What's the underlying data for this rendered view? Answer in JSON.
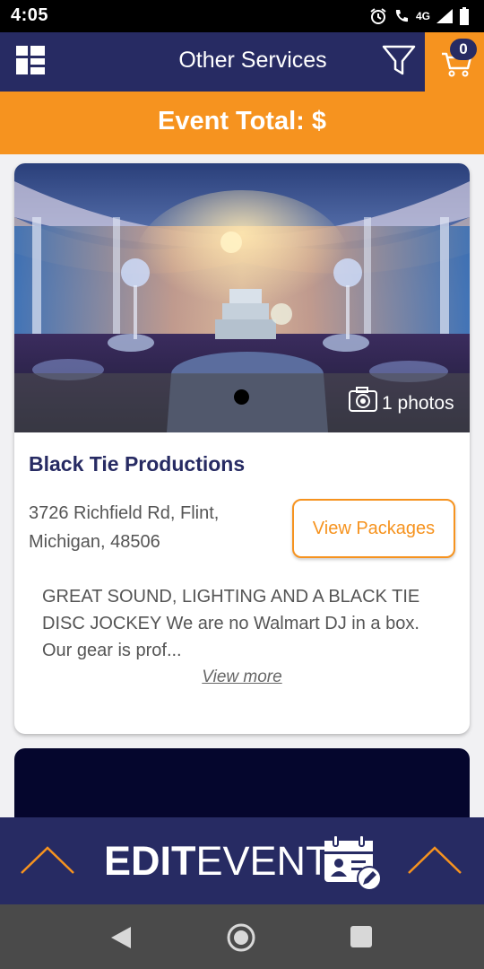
{
  "status_bar": {
    "time": "4:05",
    "network": "4G"
  },
  "header": {
    "title": "Other Services",
    "cart_count": "0",
    "menu_icon": "grid-menu-icon",
    "filter_icon": "filter-icon",
    "cart_icon": "cart-icon"
  },
  "event_total": {
    "label": "Event Total: $"
  },
  "vendor": {
    "name": "Black Tie Productions",
    "address": "3726 Richfield Rd, Flint, Michigan, 48506",
    "view_packages_label": "View Packages",
    "description": "GREAT SOUND, LIGHTING AND A BLACK TIE DISC JOCKEY We are no Walmart DJ in a box. Our gear is prof...",
    "view_more_label": "View more",
    "photo_count_label": "1 photos"
  },
  "edit_bar": {
    "edit_label": "EDIT",
    "event_label": "EVENT"
  },
  "colors": {
    "navy": "#272b63",
    "orange": "#f6931f"
  }
}
